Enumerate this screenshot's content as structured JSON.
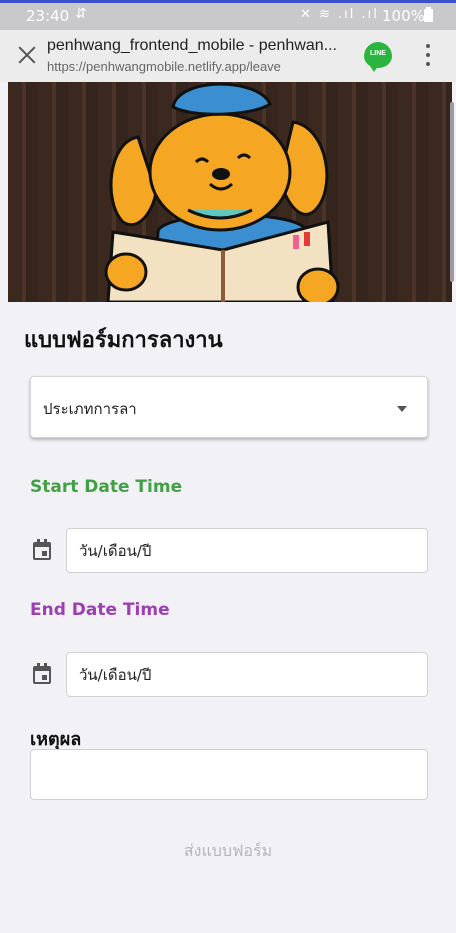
{
  "status_bar": {
    "time": "23:40",
    "battery": "100%"
  },
  "browser": {
    "page_title": "penhwang_frontend_mobile - penhwan...",
    "url": "https://penhwangmobile.netlify.app/leave",
    "line_badge": "LINE"
  },
  "form": {
    "title": "แบบฟอร์มการลางาน",
    "leave_type_placeholder": "ประเภทการลา",
    "start_label": "Start Date Time",
    "start_placeholder": "วัน/เดือน/ปี",
    "end_label": "End Date Time",
    "end_placeholder": "วัน/เดือน/ปี",
    "reason_label": "เหตุผล",
    "reason_value": "",
    "submit_label": "ส่งแบบฟอร์ม"
  },
  "colors": {
    "start_label": "#43a047",
    "end_label": "#9c3fb0",
    "submit_disabled": "#b5b5ba",
    "page_background": "#f2f2f6"
  },
  "icons": {
    "close": "close-icon",
    "more": "more-vert-icon",
    "calendar": "calendar-icon",
    "dropdown": "dropdown-arrow-icon",
    "line_app": "line-app-icon",
    "usb": "usb-icon"
  }
}
